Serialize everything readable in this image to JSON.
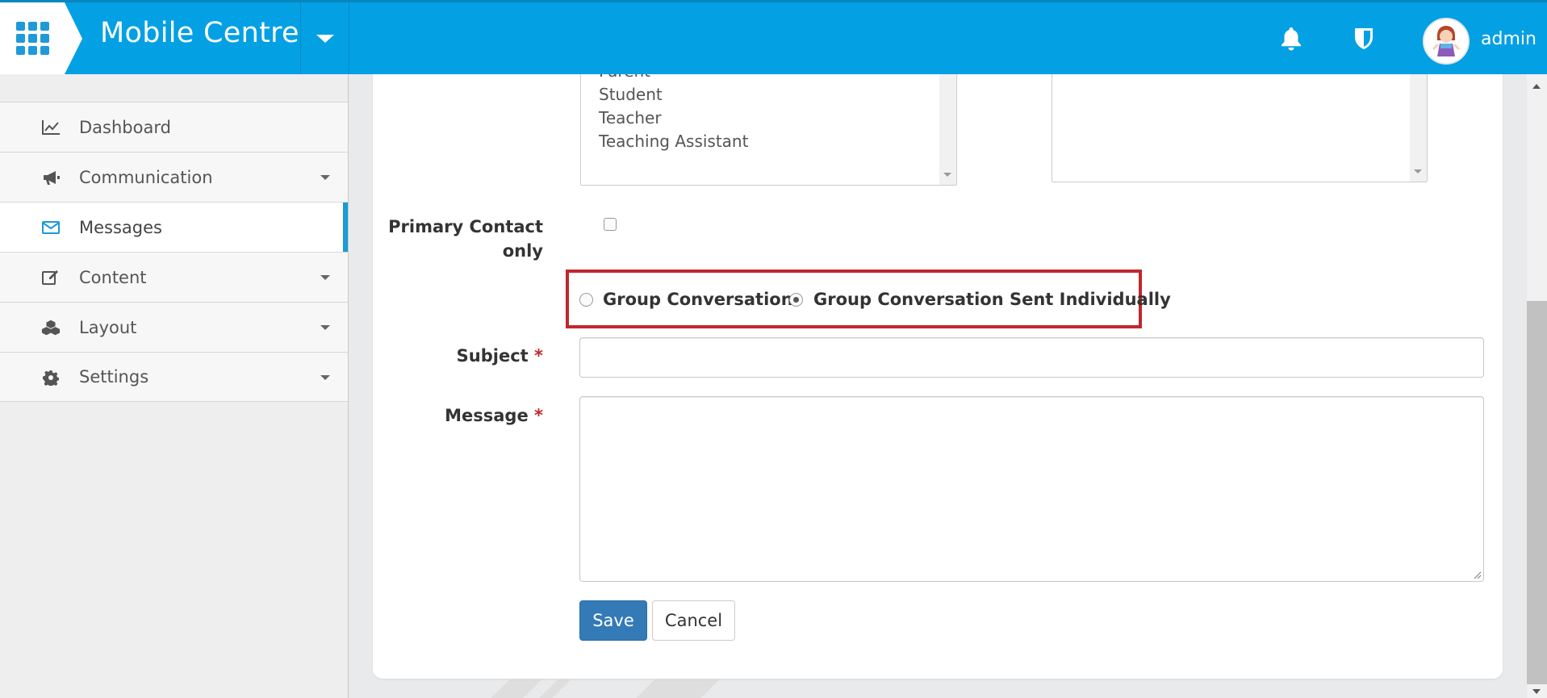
{
  "header": {
    "app_title": "Mobile Centre",
    "user_name": "admin",
    "bar_color": "#03a0e4",
    "icons": [
      "apps-grid-icon",
      "caret-down-icon",
      "bell-icon",
      "shield-icon",
      "user-avatar"
    ]
  },
  "sidebar": {
    "items": [
      {
        "label": "Dashboard",
        "icon": "line-chart-icon",
        "has_caret": false,
        "active": false
      },
      {
        "label": "Communication",
        "icon": "megaphone-icon",
        "has_caret": true,
        "active": false
      },
      {
        "label": "Messages",
        "icon": "envelope-icon",
        "has_caret": false,
        "active": true
      },
      {
        "label": "Content",
        "icon": "edit-icon",
        "has_caret": true,
        "active": false
      },
      {
        "label": "Layout",
        "icon": "cubes-icon",
        "has_caret": true,
        "active": false
      },
      {
        "label": "Settings",
        "icon": "gear-icon",
        "has_caret": true,
        "active": false
      }
    ],
    "accent_color": "#1a9ad6"
  },
  "form": {
    "recipient_roles": [
      "Parent",
      "Student",
      "Teacher",
      "Teaching Assistant"
    ],
    "primary_contact_label_line1": "Primary Contact",
    "primary_contact_label_line2": "only",
    "primary_contact_checked": false,
    "radio_options": [
      {
        "label": "Group Conversation",
        "checked": false
      },
      {
        "label": "Group Conversation Sent Individually",
        "checked": true
      }
    ],
    "highlight_color": "#c1272d",
    "subject_label": "Subject",
    "subject_value": "",
    "message_label": "Message",
    "message_value": "",
    "required_mark": "*",
    "save_label": "Save",
    "cancel_label": "Cancel"
  }
}
